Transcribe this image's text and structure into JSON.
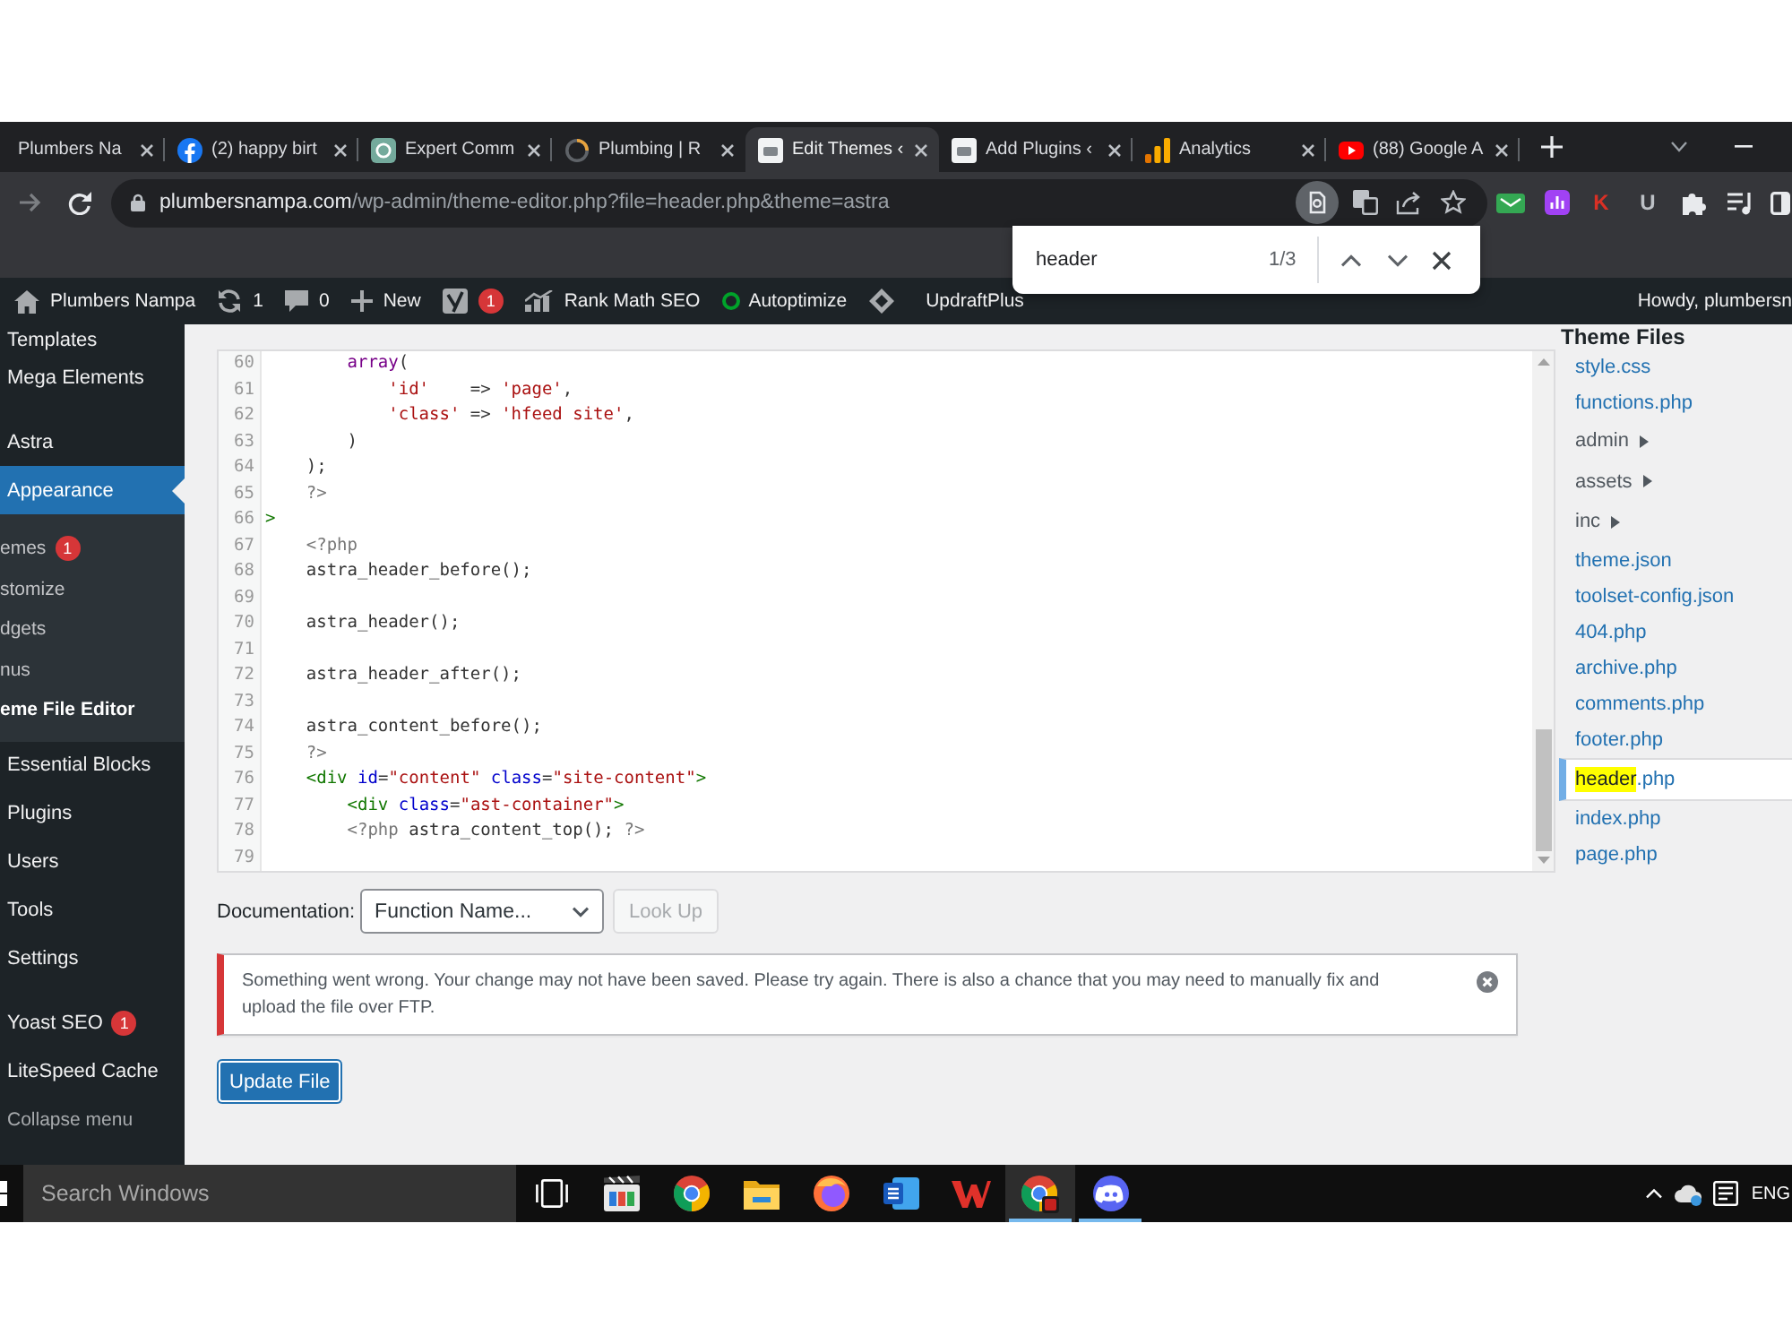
{
  "browser": {
    "tabs": [
      {
        "title": "Plumbers Na",
        "selected": false
      },
      {
        "kind": "social",
        "title": "(2) happy birt",
        "selected": false
      },
      {
        "kind": "chat",
        "title": "Expert Comm",
        "selected": false
      },
      {
        "kind": "loading",
        "title": "Plumbing | R",
        "selected": false
      },
      {
        "kind": "site",
        "title": "Edit Themes ‹",
        "selected": true
      },
      {
        "kind": "site",
        "title": "Add Plugins ‹",
        "selected": false
      },
      {
        "kind": "analytics",
        "title": "Analytics",
        "selected": false
      },
      {
        "kind": "video",
        "title": "(88) Google A",
        "selected": false
      }
    ],
    "address": {
      "host": "plumbersnampa.com",
      "path": "/wp-admin/theme-editor.php?file=header.php&theme=astra"
    },
    "extensions": [
      {
        "glyph": "K",
        "color": "#d93025"
      },
      {
        "glyph": "U",
        "color": "#bdc1c6"
      }
    ]
  },
  "find_bar": {
    "query": "header",
    "count": "1/3"
  },
  "admin_bar": {
    "items": [
      {
        "kind": "home",
        "label": "Plumbers Nampa"
      },
      {
        "kind": "updates",
        "label": "1"
      },
      {
        "kind": "comments",
        "label": "0"
      },
      {
        "kind": "new",
        "label": "New"
      },
      {
        "kind": "seo",
        "badge": "1"
      },
      {
        "kind": "chart",
        "label": "Rank Math SEO"
      },
      {
        "kind": "status",
        "label": "Autoptimize"
      },
      {
        "kind": "diamond",
        "label": "UpdraftPlus"
      }
    ],
    "account": "Howdy, plumbersn"
  },
  "sidebar": {
    "groups": [
      {
        "items": [
          {
            "label": "Templates",
            "selected": false
          },
          {
            "label": "Mega Elements",
            "selected": false
          }
        ]
      },
      {
        "items": [
          {
            "label": "Astra",
            "selected": false
          },
          {
            "label": "Appearance",
            "selected": true,
            "children": [
              {
                "label": "emes",
                "badge": "1",
                "selected": false
              },
              {
                "label": "stomize",
                "selected": false
              },
              {
                "label": "dgets",
                "selected": false
              },
              {
                "label": "nus",
                "selected": false
              },
              {
                "label": "eme File Editor",
                "selected": true
              }
            ]
          },
          {
            "label": "Essential Blocks",
            "selected": false
          },
          {
            "label": "Plugins",
            "selected": false
          },
          {
            "label": "Users",
            "selected": false
          },
          {
            "label": "Tools",
            "selected": false
          },
          {
            "label": "Settings",
            "selected": false
          }
        ]
      },
      {
        "items": [
          {
            "label": "Yoast SEO",
            "badge": "1",
            "selected": false
          },
          {
            "label": "LiteSpeed Cache",
            "selected": false
          }
        ]
      }
    ],
    "collapse": "Collapse menu"
  },
  "editor": {
    "heading": "Theme Files",
    "lines": [
      {
        "number": "60",
        "tokens": [
          {
            "kind": "keyword",
            "text": "        array"
          },
          {
            "kind": "plain",
            "text": "("
          }
        ]
      },
      {
        "number": "61",
        "tokens": [
          {
            "kind": "string",
            "text": "            'id'"
          },
          {
            "kind": "plain",
            "text": "    => "
          },
          {
            "kind": "string",
            "text": "'page'"
          },
          {
            "kind": "plain",
            "text": ","
          }
        ]
      },
      {
        "number": "62",
        "tokens": [
          {
            "kind": "string",
            "text": "            'class'"
          },
          {
            "kind": "plain",
            "text": " => "
          },
          {
            "kind": "string",
            "text": "'hfeed site'"
          },
          {
            "kind": "plain",
            "text": ","
          }
        ]
      },
      {
        "number": "63",
        "tokens": [
          {
            "kind": "plain",
            "text": "        )"
          }
        ]
      },
      {
        "number": "64",
        "tokens": [
          {
            "kind": "plain",
            "text": "    );"
          }
        ]
      },
      {
        "number": "65",
        "tokens": [
          {
            "kind": "meta",
            "text": "    ?>"
          }
        ]
      },
      {
        "number": "66",
        "tokens": [
          {
            "kind": "tag",
            "text": ">"
          }
        ]
      },
      {
        "number": "67",
        "tokens": [
          {
            "kind": "meta",
            "text": "    <?php"
          }
        ]
      },
      {
        "number": "68",
        "tokens": [
          {
            "kind": "plain",
            "text": "    astra_header_before();"
          }
        ]
      },
      {
        "number": "69"
      },
      {
        "number": "70",
        "tokens": [
          {
            "kind": "plain",
            "text": "    astra_header();"
          }
        ]
      },
      {
        "number": "71"
      },
      {
        "number": "72",
        "tokens": [
          {
            "kind": "plain",
            "text": "    astra_header_after();"
          }
        ]
      },
      {
        "number": "73"
      },
      {
        "number": "74",
        "tokens": [
          {
            "kind": "plain",
            "text": "    astra_content_before();"
          }
        ]
      },
      {
        "number": "75",
        "tokens": [
          {
            "kind": "meta",
            "text": "    ?>"
          }
        ]
      },
      {
        "number": "76",
        "tokens": [
          {
            "kind": "tag",
            "text": "    <div"
          },
          {
            "kind": "attribute",
            "text": " id"
          },
          {
            "kind": "plain",
            "text": "="
          },
          {
            "kind": "string",
            "text": "\"content\""
          },
          {
            "kind": "attribute",
            "text": " class"
          },
          {
            "kind": "plain",
            "text": "="
          },
          {
            "kind": "string",
            "text": "\"site-content\""
          },
          {
            "kind": "tag",
            "text": ">"
          }
        ]
      },
      {
        "number": "77",
        "tokens": [
          {
            "kind": "tag",
            "text": "        <div"
          },
          {
            "kind": "attribute",
            "text": " class"
          },
          {
            "kind": "plain",
            "text": "="
          },
          {
            "kind": "string",
            "text": "\"ast-container\""
          },
          {
            "kind": "tag",
            "text": ">"
          }
        ]
      },
      {
        "number": "78",
        "tokens": [
          {
            "kind": "meta",
            "text": "        <?php"
          },
          {
            "kind": "plain",
            "text": " astra_content_top(); "
          },
          {
            "kind": "meta",
            "text": "?>"
          }
        ]
      },
      {
        "number": "79"
      }
    ],
    "files": [
      {
        "kind": "file",
        "name": "style.css",
        "selected": false
      },
      {
        "kind": "file",
        "name": "functions.php",
        "selected": false
      },
      {
        "kind": "folder",
        "name": "admin",
        "expanded": false,
        "selected": false
      },
      {
        "kind": "folder",
        "name": "assets",
        "expanded": false,
        "selected": false
      },
      {
        "kind": "folder",
        "name": "inc",
        "expanded": false,
        "selected": false
      },
      {
        "kind": "file",
        "name": "theme.json",
        "selected": false
      },
      {
        "kind": "file",
        "name": "toolset-config.json",
        "selected": false
      },
      {
        "kind": "file",
        "name": "404.php",
        "selected": false
      },
      {
        "kind": "file",
        "name": "archive.php",
        "selected": false
      },
      {
        "kind": "file",
        "name": "comments.php",
        "selected": false
      },
      {
        "kind": "file",
        "name": "footer.php",
        "selected": false
      },
      {
        "kind": "file",
        "parts": [
          {
            "text": "header",
            "match": true
          },
          {
            "text": ".php",
            "match": false
          }
        ],
        "selected": true
      },
      {
        "kind": "file",
        "name": "index.php",
        "selected": false
      },
      {
        "kind": "file",
        "name": "page.php",
        "selected": false
      }
    ],
    "documentation": {
      "label": "Documentation:",
      "value": "Function Name...",
      "button": {
        "label": "Look Up",
        "disabled": true
      }
    },
    "notice": {
      "kind": "error",
      "text": "Something went wrong. Your change may not have been saved. Please try again. There is also a chance that you may need to manually fix and upload the file over FTP."
    },
    "update_button": "Update File"
  },
  "taskbar": {
    "search": {
      "placeholder": "Search Windows"
    },
    "apps": [
      {
        "kind": "task-view",
        "running": false,
        "active": false
      },
      {
        "kind": "media",
        "running": false,
        "active": false
      },
      {
        "kind": "browser",
        "running": false,
        "active": false
      },
      {
        "kind": "files",
        "running": false,
        "active": false
      },
      {
        "kind": "browser-alt",
        "running": false,
        "active": false
      },
      {
        "kind": "document",
        "running": false,
        "active": false
      },
      {
        "kind": "office",
        "running": false,
        "active": false
      },
      {
        "kind": "browser-profile",
        "running": true,
        "active": true
      },
      {
        "kind": "chat",
        "running": true,
        "active": false
      }
    ],
    "language": "ENG"
  }
}
